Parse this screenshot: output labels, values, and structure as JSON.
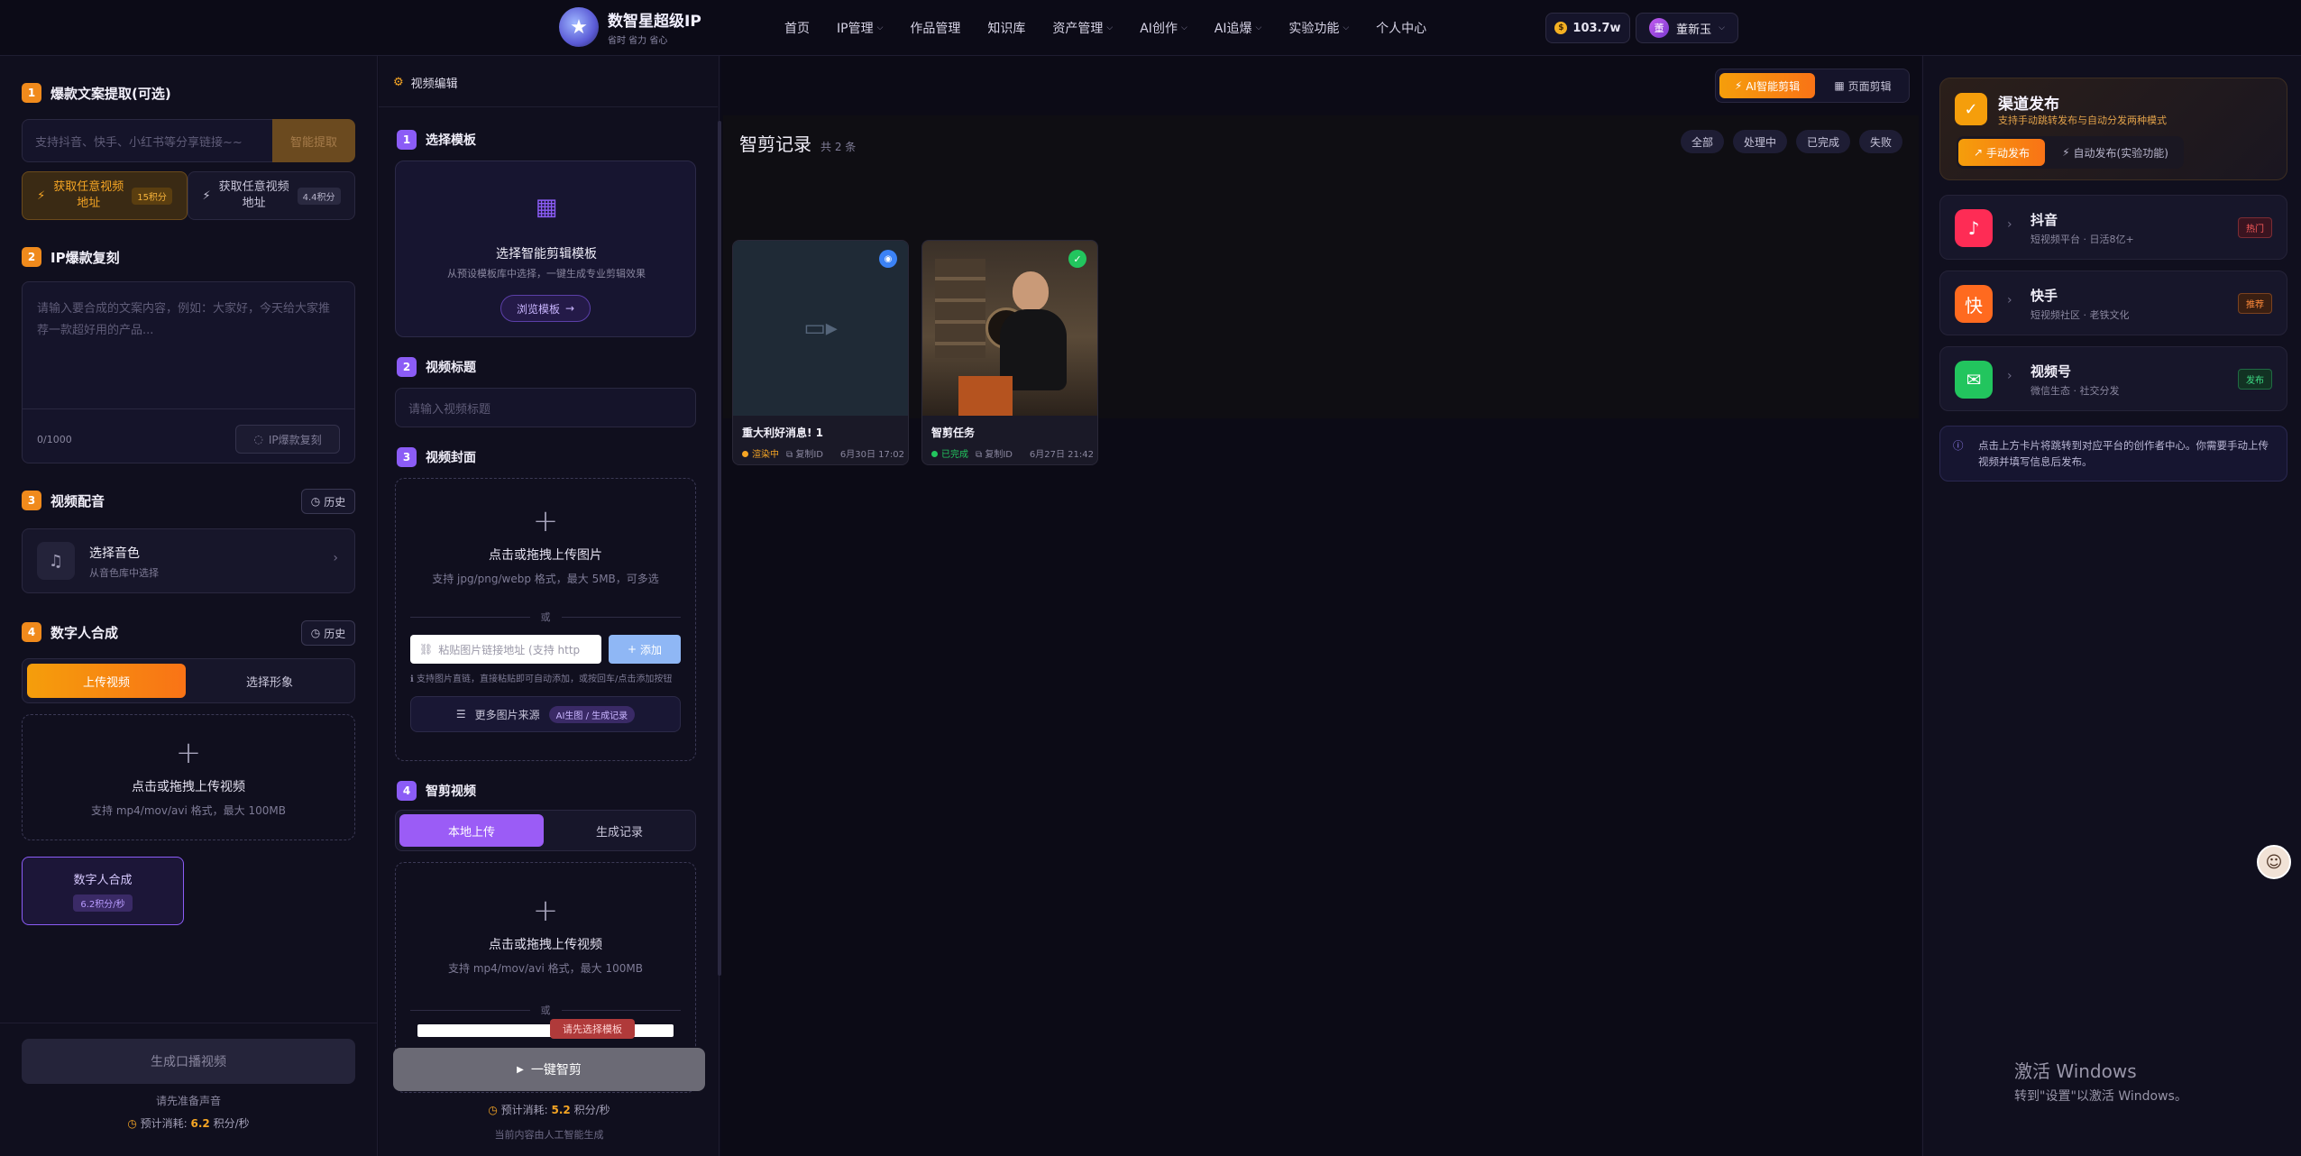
{
  "app": {
    "name": "数智星超级IP",
    "tagline": "省时 省力 省心",
    "credits": "103.7w",
    "user_name": "董新玉",
    "user_initial": "董"
  },
  "nav": [
    "首页",
    "IP管理",
    "作品管理",
    "知识库",
    "资产管理",
    "AI创作",
    "AI追爆",
    "实验功能",
    "个人中心"
  ],
  "nav_dropdown": [
    false,
    true,
    false,
    false,
    true,
    true,
    true,
    true,
    false
  ],
  "left": {
    "s1": {
      "num": "1",
      "title": "爆款文案提取(可选)",
      "placeholder": "支持抖音、快手、小红书等分享链接~~",
      "extract_btn": "智能提取",
      "opt1_label": "获取任意视频地址",
      "opt1_cost": "15积分",
      "opt2_label": "获取任意视频地址",
      "opt2_cost": "4.4积分"
    },
    "s2": {
      "num": "2",
      "title": "IP爆款复刻",
      "placeholder": "请输入要合成的文案内容，例如：大家好，今天给大家推荐一款超好用的产品...",
      "counter": "0/1000",
      "copy_btn": "IP爆款复刻"
    },
    "s3": {
      "num": "3",
      "title": "视频配音",
      "history": "历史",
      "voice_title": "选择音色",
      "voice_sub": "从音色库中选择"
    },
    "s4": {
      "num": "4",
      "title": "数字人合成",
      "history": "历史",
      "tab_upload": "上传视频",
      "tab_select": "选择形象",
      "upload_title": "点击或拖拽上传视频",
      "upload_sub": "支持 mp4/mov/avi 格式，最大 100MB",
      "synth_title": "数字人合成",
      "synth_cost": "6.2积分/秒"
    },
    "bottom": {
      "generate_btn": "生成口播视频",
      "hint": "请先准备声音",
      "cost_prefix": "预计消耗:",
      "cost_value": "6.2",
      "cost_suffix": "积分/秒"
    }
  },
  "mid": {
    "header": "视频编辑",
    "s1": {
      "num": "1",
      "title": "选择模板",
      "card_title": "选择智能剪辑模板",
      "card_sub": "从预设模板库中选择，一键生成专业剪辑效果",
      "browse_btn": "浏览模板"
    },
    "s2": {
      "num": "2",
      "title": "视频标题",
      "placeholder": "请输入视频标题"
    },
    "s3": {
      "num": "3",
      "title": "视频封面",
      "upload_title": "点击或拖拽上传图片",
      "upload_sub": "支持 jpg/png/webp 格式，最大 5MB，可多选",
      "or": "或",
      "link_placeholder": "粘贴图片链接地址 (支持 http",
      "add_btn": "添加",
      "tip": "支持图片直链，直接粘贴即可自动添加，或按回车/点击添加按钮",
      "more_sources": "更多图片来源",
      "more_tag": "AI生图 / 生成记录"
    },
    "s4": {
      "num": "4",
      "title": "智剪视频",
      "tab_local": "本地上传",
      "tab_records": "生成记录",
      "upload_title": "点击或拖拽上传视频",
      "upload_sub": "支持 mp4/mov/avi 格式，最大 100MB",
      "or": "或",
      "toast": "请先选择模板"
    },
    "bottom": {
      "go_btn": "一键智剪",
      "cost_prefix": "预计消耗:",
      "cost_value": "5.2",
      "cost_suffix": "积分/秒",
      "ai_note": "当前内容由人工智能生成"
    }
  },
  "center": {
    "tab_ai": "AI智能剪辑",
    "tab_page": "页面剪辑",
    "title": "智剪记录",
    "count": "共 2 条",
    "filters": [
      "全部",
      "处理中",
      "已完成",
      "失败"
    ],
    "cards": [
      {
        "title": "重大利好消息! 1",
        "status": "渲染中",
        "status_color": "#f5a524",
        "id_label": "复制ID",
        "time": "6月30日 17:02"
      },
      {
        "title": "智剪任务",
        "status": "已完成",
        "status_color": "#22c55e",
        "id_label": "复制ID",
        "time": "6月27日 21:42"
      }
    ]
  },
  "right": {
    "pub_title": "渠道发布",
    "pub_sub": "支持手动跳转发布与自动分发两种模式",
    "manual_btn": "手动发布",
    "auto_btn": "自动发布(实验功能)",
    "platforms": [
      {
        "name": "抖音",
        "desc": "短视频平台 · 日活8亿+",
        "tag": "热门",
        "icon": "♪",
        "color": "#fe2c55",
        "tag_color": "#ff5c5c",
        "tag_bg": "#3a1420"
      },
      {
        "name": "快手",
        "desc": "短视频社区 · 老铁文化",
        "tag": "推荐",
        "icon": "快",
        "color": "#ff6a1f",
        "tag_color": "#ff8a3a",
        "tag_bg": "#3a1f12"
      },
      {
        "name": "视频号",
        "desc": "微信生态 · 社交分发",
        "tag": "发布",
        "icon": "✉",
        "color": "#22c55e",
        "tag_color": "#3ddc84",
        "tag_bg": "#123223"
      }
    ],
    "info": "点击上方卡片将跳转到对应平台的创作者中心。你需要手动上传视频并填写信息后发布。"
  },
  "windows": {
    "line1": "激活 Windows",
    "line2": "转到\"设置\"以激活 Windows。"
  }
}
